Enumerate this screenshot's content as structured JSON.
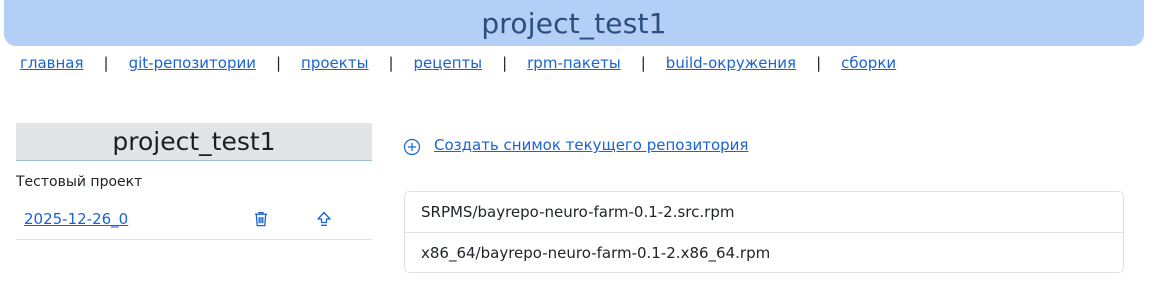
{
  "banner": {
    "title": "project_test1"
  },
  "nav": {
    "items": [
      {
        "label": "главная"
      },
      {
        "label": "git-репозитории"
      },
      {
        "label": "проекты"
      },
      {
        "label": "рецепты"
      },
      {
        "label": "rpm-пакеты"
      },
      {
        "label": "build-окружения"
      },
      {
        "label": "сборки"
      }
    ],
    "separator": "|"
  },
  "project": {
    "title": "project_test1",
    "description": "Тестовый проект",
    "snapshots": [
      {
        "label": "2025-12-26_0",
        "icons": [
          "trash-icon",
          "upload-icon"
        ]
      }
    ]
  },
  "actions": {
    "create_snapshot_label": "Создать снимок текущего репозитория",
    "icon": "plus-circle-icon"
  },
  "files": [
    {
      "path": "SRPMS/bayrepo-neuro-farm-0.1-2.src.rpm"
    },
    {
      "path": "x86_64/bayrepo-neuro-farm-0.1-2.x86_64.rpm"
    }
  ],
  "colors": {
    "banner": "#b3cff5",
    "link": "#1a63d6",
    "header_bg": "#e3e4e6"
  }
}
